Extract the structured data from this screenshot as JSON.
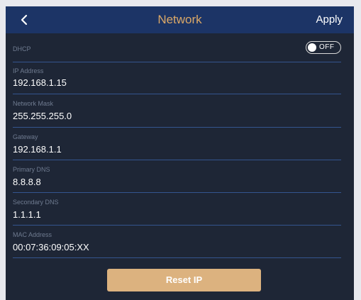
{
  "header": {
    "title": "Network",
    "apply_label": "Apply",
    "back_icon": "chevron-left-icon"
  },
  "dhcp": {
    "label": "DHCP",
    "state": "OFF"
  },
  "fields": [
    {
      "label": "IP Address",
      "value": "192.168.1.15"
    },
    {
      "label": "Network Mask",
      "value": "255.255.255.0"
    },
    {
      "label": "Gateway",
      "value": "192.168.1.1"
    },
    {
      "label": "Primary DNS",
      "value": "8.8.8.8"
    },
    {
      "label": "Secondary DNS",
      "value": "1.1.1.1"
    },
    {
      "label": "MAC Address",
      "value": "00:07:36:09:05:XX"
    }
  ],
  "reset_label": "Reset IP",
  "colors": {
    "header_bg": "#1c3466",
    "panel_bg": "#1e2636",
    "accent": "#dba867",
    "button": "#dcb27f",
    "divider": "#34558f"
  }
}
